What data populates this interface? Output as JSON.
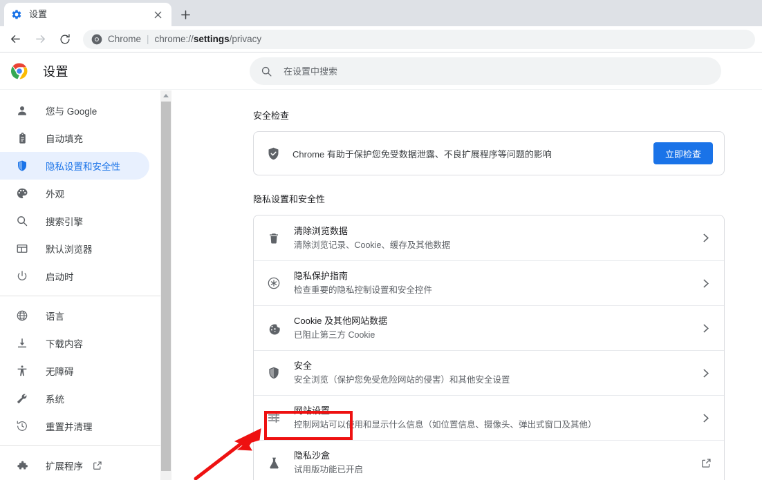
{
  "browser": {
    "tab": {
      "title": "设置",
      "favicon_icon": "gear-icon",
      "close_icon": "close-icon"
    },
    "newtab_icon": "plus-icon",
    "back_icon": "arrow-left-icon",
    "forward_icon": "arrow-right-icon",
    "reload_icon": "reload-icon",
    "omnibox": {
      "site_icon": "chrome-icon",
      "chip": "Chrome",
      "separator": "|",
      "url_prefix": "chrome://",
      "url_bold": "settings",
      "url_suffix": "/privacy"
    }
  },
  "header": {
    "logo_icon": "chrome-logo-icon",
    "title": "设置",
    "search": {
      "icon": "search-icon",
      "placeholder": "在设置中搜索",
      "value": ""
    }
  },
  "sidebar": {
    "scrollbar_icon": "scroll-up-arrow-icon",
    "items": [
      {
        "icon": "person-icon",
        "label": "您与 Google",
        "active": false
      },
      {
        "icon": "clipboard-icon",
        "label": "自动填充",
        "active": false
      },
      {
        "icon": "shield-icon",
        "label": "隐私设置和安全性",
        "active": true
      },
      {
        "icon": "palette-icon",
        "label": "外观",
        "active": false
      },
      {
        "icon": "magnifier-icon",
        "label": "搜索引擎",
        "active": false
      },
      {
        "icon": "browser-icon",
        "label": "默认浏览器",
        "active": false
      },
      {
        "icon": "power-icon",
        "label": "启动时",
        "active": false
      },
      {
        "icon": "globe-icon",
        "label": "语言",
        "active": false
      },
      {
        "icon": "download-icon",
        "label": "下载内容",
        "active": false
      },
      {
        "icon": "accessibility-icon",
        "label": "无障碍",
        "active": false
      },
      {
        "icon": "wrench-icon",
        "label": "系统",
        "active": false
      },
      {
        "icon": "history-icon",
        "label": "重置并清理",
        "active": false
      }
    ],
    "extensions": {
      "icon": "puzzle-icon",
      "label": "扩展程序",
      "external_icon": "external-link-icon"
    }
  },
  "main": {
    "safety_check": {
      "title": "安全检查",
      "icon": "shield-check-icon",
      "description": "Chrome 有助于保护您免受数据泄露、不良扩展程序等问题的影响",
      "button": "立即检查"
    },
    "privacy": {
      "title": "隐私设置和安全性",
      "rows": [
        {
          "icon": "trash-icon",
          "title": "清除浏览数据",
          "sub": "清除浏览记录、Cookie、缓存及其他数据",
          "action_icon": "chevron-right-icon",
          "highlighted": false
        },
        {
          "icon": "privacy-guide-icon",
          "title": "隐私保护指南",
          "sub": "检查重要的隐私控制设置和安全控件",
          "action_icon": "chevron-right-icon",
          "highlighted": false
        },
        {
          "icon": "cookie-icon",
          "title": "Cookie 及其他网站数据",
          "sub": "已阻止第三方 Cookie",
          "action_icon": "chevron-right-icon",
          "highlighted": false
        },
        {
          "icon": "shield-icon",
          "title": "安全",
          "sub": "安全浏览（保护您免受危险网站的侵害）和其他安全设置",
          "action_icon": "chevron-right-icon",
          "highlighted": false
        },
        {
          "icon": "tune-icon",
          "title": "网站设置",
          "sub": "控制网站可以使用和显示什么信息（如位置信息、摄像头、弹出式窗口及其他）",
          "action_icon": "chevron-right-icon",
          "highlighted": true
        },
        {
          "icon": "flask-icon",
          "title": "隐私沙盒",
          "sub": "试用版功能已开启",
          "action_icon": "external-link-icon",
          "highlighted": false
        }
      ]
    }
  },
  "annotation": {
    "color": "#ee1111",
    "box_target": "网站设置",
    "arrow_icon": "pointer-arrow-icon"
  }
}
